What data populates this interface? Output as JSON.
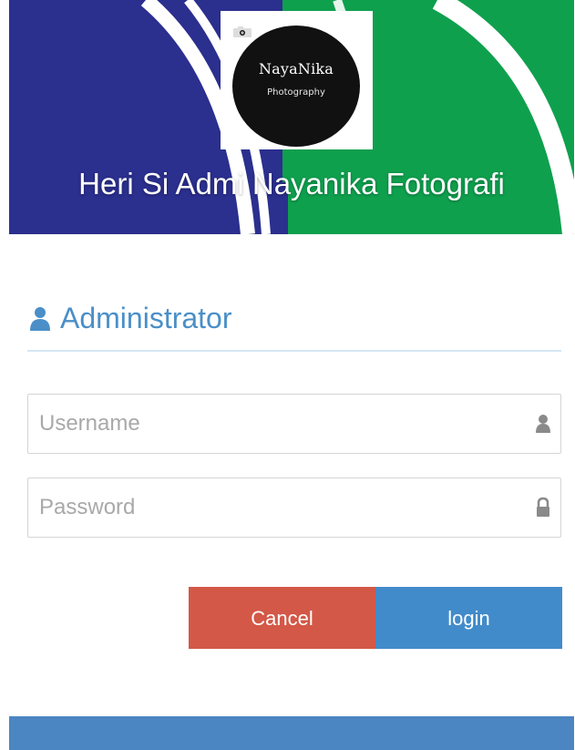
{
  "banner": {
    "title": "Heri Si Admi Nayanika Fotografi",
    "colors": {
      "blue": "#2b2f8e",
      "green": "#0fa04e",
      "arc": "#ffffff"
    }
  },
  "logo": {
    "name": "NayaNika",
    "subtitle": "Photography",
    "icon": "camera-icon"
  },
  "panel": {
    "title": "Administrator",
    "title_icon": "user-icon",
    "accent": "#4a8fc8"
  },
  "form": {
    "username": {
      "placeholder": "Username",
      "value": "",
      "icon": "user-icon"
    },
    "password": {
      "placeholder": "Password",
      "value": "",
      "icon": "lock-icon"
    }
  },
  "buttons": {
    "cancel": {
      "label": "Cancel",
      "color": "#d35847"
    },
    "login": {
      "label": "login",
      "color": "#428bca"
    }
  },
  "footer": {
    "color": "#4b86c2"
  }
}
